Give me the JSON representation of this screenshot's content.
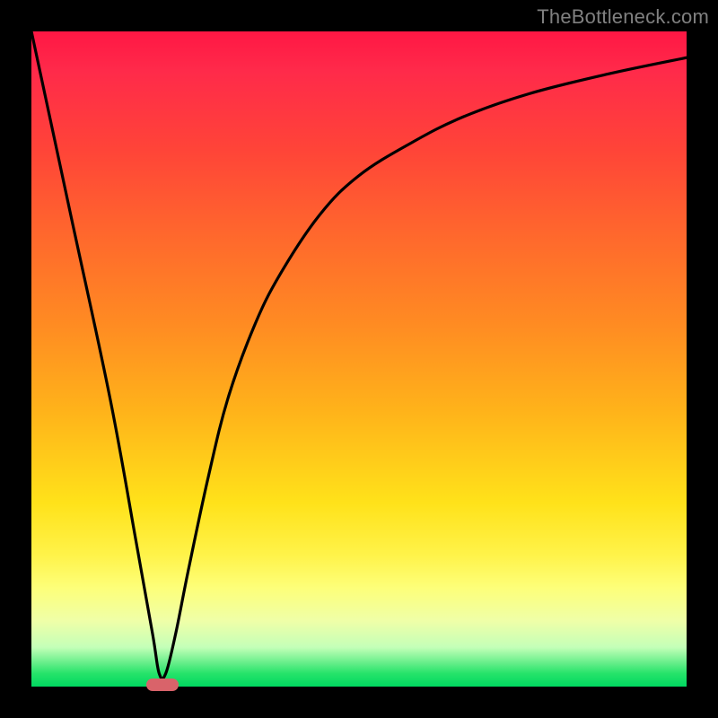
{
  "watermark": "TheBottleneck.com",
  "chart_data": {
    "type": "line",
    "title": "",
    "xlabel": "",
    "ylabel": "",
    "xlim": [
      0,
      100
    ],
    "ylim": [
      0,
      100
    ],
    "series": [
      {
        "name": "curve",
        "x": [
          0,
          6,
          12,
          16,
          18.5,
          19.5,
          20.5,
          22,
          24,
          27,
          30,
          34,
          38,
          44,
          50,
          58,
          66,
          76,
          88,
          100
        ],
        "values": [
          100,
          72,
          44,
          22,
          8,
          2,
          2,
          8,
          18,
          32,
          44,
          55,
          63,
          72,
          78,
          83,
          87,
          90.5,
          93.5,
          96
        ]
      }
    ],
    "marker": {
      "x_center": 20,
      "y": 0,
      "width": 5
    },
    "gradient_stops": [
      {
        "pos": 0,
        "color": "#ff1744"
      },
      {
        "pos": 18,
        "color": "#ff4438"
      },
      {
        "pos": 45,
        "color": "#ff8c22"
      },
      {
        "pos": 72,
        "color": "#ffe21a"
      },
      {
        "pos": 90,
        "color": "#efffa8"
      },
      {
        "pos": 100,
        "color": "#00d860"
      }
    ]
  }
}
